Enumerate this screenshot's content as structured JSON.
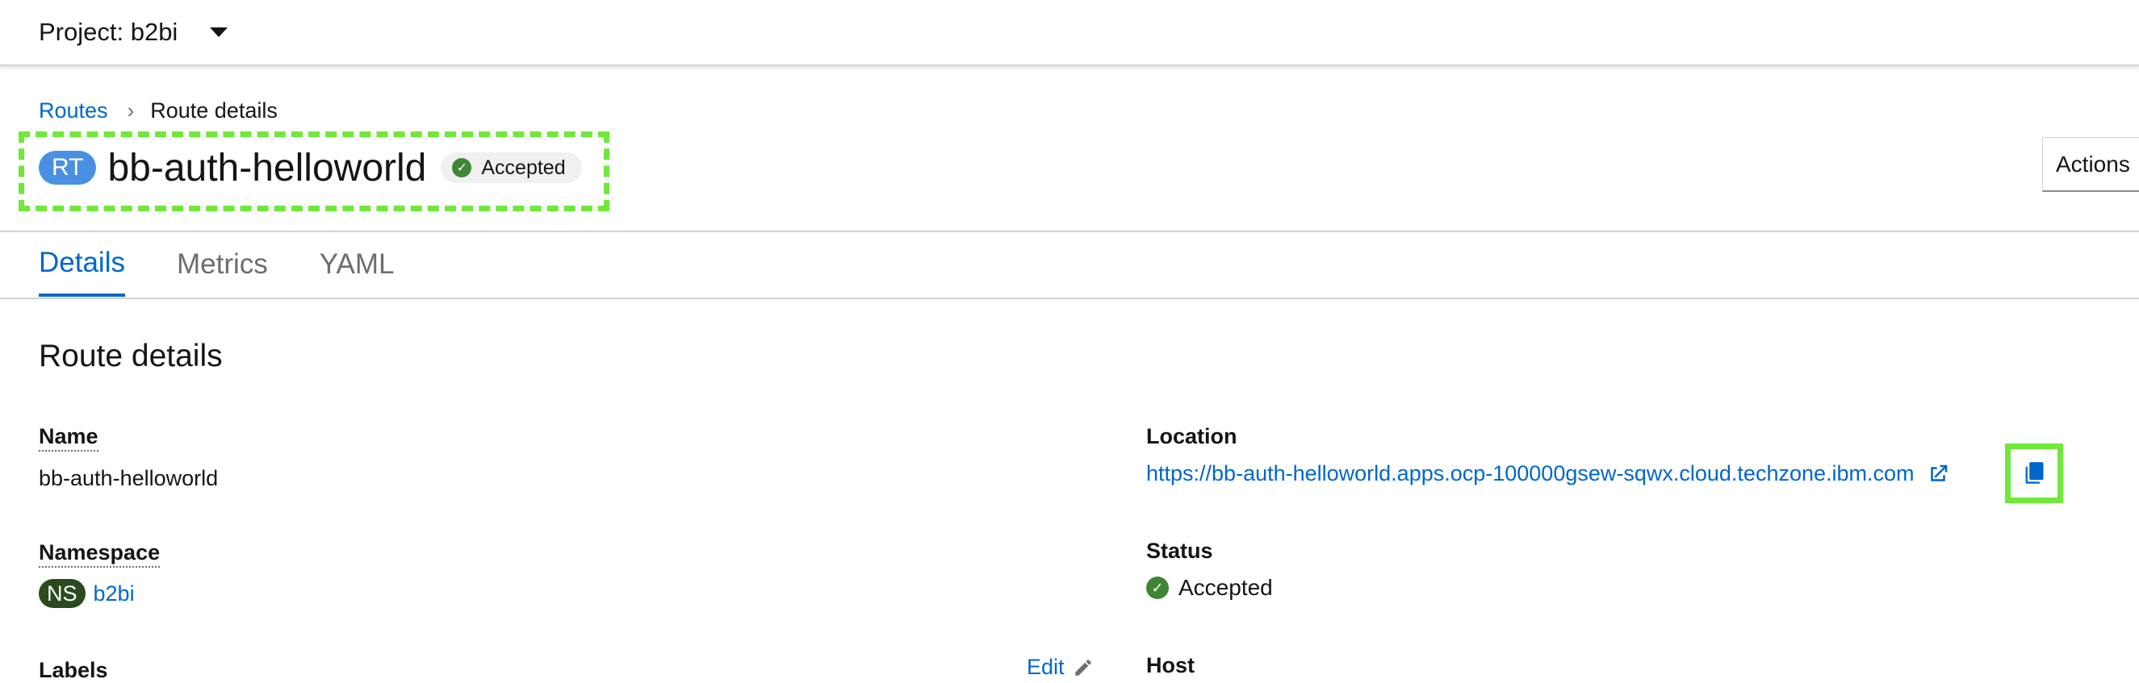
{
  "topbar": {
    "project_label": "Project: b2bi"
  },
  "breadcrumb": {
    "parent": "Routes",
    "current": "Route details"
  },
  "header": {
    "resource_badge": "RT",
    "title": "bb-auth-helloworld",
    "status": "Accepted",
    "actions_label": "Actions"
  },
  "tabs": [
    {
      "label": "Details",
      "active": true
    },
    {
      "label": "Metrics",
      "active": false
    },
    {
      "label": "YAML",
      "active": false
    }
  ],
  "section_title": "Route details",
  "left_fields": {
    "name_label": "Name",
    "name_value": "bb-auth-helloworld",
    "namespace_label": "Namespace",
    "namespace_badge": "NS",
    "namespace_value": "b2bi",
    "labels_label": "Labels",
    "edit_label": "Edit"
  },
  "right_fields": {
    "location_label": "Location",
    "location_url": "https://bb-auth-helloworld.apps.ocp-100000gsew-sqwx.cloud.techzone.ibm.com",
    "status_label": "Status",
    "status_value": "Accepted",
    "host_label": "Host"
  },
  "colors": {
    "link": "#0066cc",
    "success": "#3e8635",
    "highlight": "#6fe83a",
    "resource_badge": "#4a90e2",
    "namespace_badge": "#2b4a1e"
  }
}
